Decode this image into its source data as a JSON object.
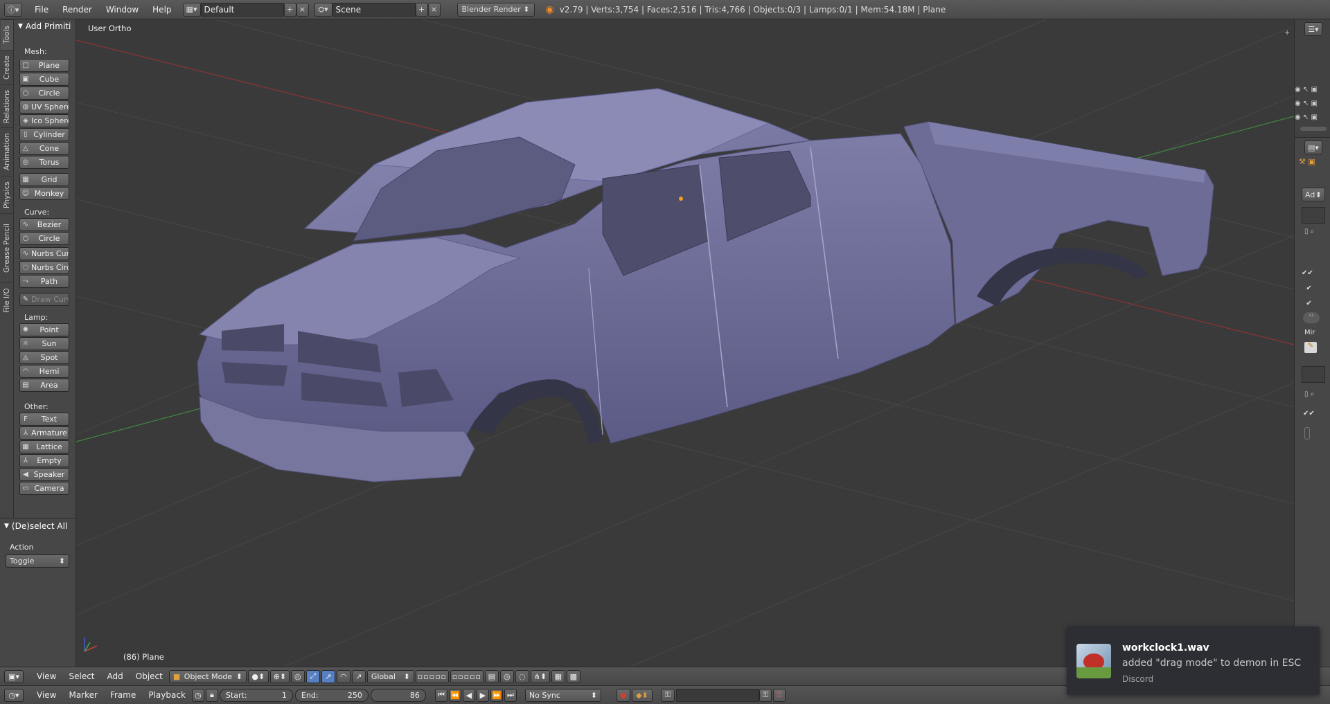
{
  "topbar": {
    "menus": [
      "File",
      "Render",
      "Window",
      "Help"
    ],
    "screen_layout": "Default",
    "scene": "Scene",
    "render_engine": "Blender Render",
    "stats": "v2.79 | Verts:3,754 | Faces:2,516 | Tris:4,766 | Objects:0/3 | Lamps:0/1 | Mem:54.18M | Plane"
  },
  "tabs": [
    "Tools",
    "Create",
    "Relations",
    "Animation",
    "Physics",
    "Grease Pencil",
    "File I/O"
  ],
  "toolshelf": {
    "title": "Add Primiti",
    "mesh_label": "Mesh:",
    "mesh": [
      "Plane",
      "Cube",
      "Circle",
      "UV Sphere",
      "Ico Sphere",
      "Cylinder",
      "Cone",
      "Torus",
      "Grid",
      "Monkey"
    ],
    "curve_label": "Curve:",
    "curve": [
      "Bezier",
      "Circle",
      "Nurbs Curv",
      "Nurbs Circl",
      "Path",
      "Draw Curv"
    ],
    "lamp_label": "Lamp:",
    "lamp": [
      "Point",
      "Sun",
      "Spot",
      "Hemi",
      "Area"
    ],
    "other_label": "Other:",
    "other": [
      "Text",
      "Armature",
      "Lattice",
      "Empty",
      "Speaker",
      "Camera"
    ]
  },
  "operator": {
    "title": "(De)select All",
    "action_label": "Action",
    "action_value": "Toggle"
  },
  "viewport": {
    "view_name": "User Ortho",
    "object_info": "(86) Plane"
  },
  "right_panel": {
    "ad_label": "Ad",
    "mir_label": "Mir"
  },
  "view3d_header": {
    "menus": [
      "View",
      "Select",
      "Add",
      "Object"
    ],
    "mode": "Object Mode",
    "orientation": "Global"
  },
  "timeline": {
    "menus": [
      "View",
      "Marker",
      "Frame",
      "Playback"
    ],
    "start_label": "Start:",
    "start_value": "1",
    "end_label": "End:",
    "end_value": "250",
    "current_frame": "86",
    "sync": "No Sync"
  },
  "notification": {
    "title": "workclock1.wav",
    "message": "added \"drag mode\" to demon in ESC",
    "app": "Discord"
  },
  "colors": {
    "mesh": "#64648e",
    "viewport_bg": "#3a3a3a",
    "x_axis": "#8c3434",
    "y_axis": "#3f8a3f"
  }
}
